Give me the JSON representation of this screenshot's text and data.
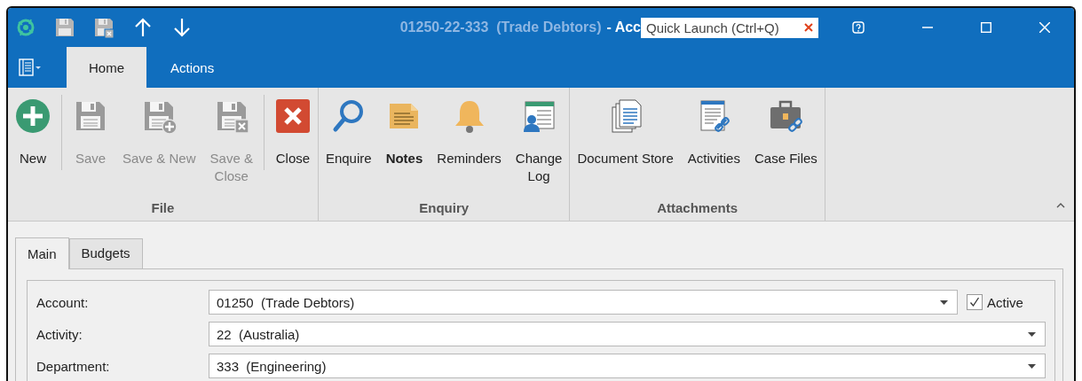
{
  "window": {
    "title_record": "01250-22-333  (Trade Debtors)",
    "title_suffix": "- Acc",
    "quick_launch": {
      "placeholder": "Quick Launch (Ctrl+Q)"
    }
  },
  "quick_access": [
    {
      "kind": "logo"
    },
    {
      "kind": "save"
    },
    {
      "kind": "save-close"
    },
    {
      "kind": "up"
    },
    {
      "kind": "down"
    }
  ],
  "ribbon_tabs": [
    {
      "label": "Home",
      "selected": true
    },
    {
      "label": "Actions",
      "selected": false
    }
  ],
  "ribbon_groups": [
    {
      "label": "File",
      "sections": [
        [
          {
            "label": "New",
            "kind": "new",
            "disabled": false,
            "bold": false
          }
        ],
        [
          {
            "label": "Save",
            "kind": "save",
            "disabled": true,
            "bold": false
          },
          {
            "label": "Save & New",
            "kind": "save-new",
            "disabled": true,
            "bold": false
          },
          {
            "label": "Save &\nClose",
            "kind": "save-close",
            "disabled": true,
            "bold": false
          }
        ],
        [
          {
            "label": "Close",
            "kind": "close",
            "disabled": false,
            "bold": false
          }
        ]
      ]
    },
    {
      "label": "Enquiry",
      "sections": [
        [
          {
            "label": "Enquire",
            "kind": "enquire",
            "disabled": false,
            "bold": false
          },
          {
            "label": "Notes",
            "kind": "notes",
            "disabled": false,
            "bold": true
          },
          {
            "label": "Reminders",
            "kind": "reminders",
            "disabled": false,
            "bold": false
          },
          {
            "label": "Change\nLog",
            "kind": "change-log",
            "disabled": false,
            "bold": false
          }
        ]
      ]
    },
    {
      "label": "Attachments",
      "sections": [
        [
          {
            "label": "Document Store",
            "kind": "documents",
            "disabled": false,
            "bold": false
          },
          {
            "label": "Activities",
            "kind": "activities",
            "disabled": false,
            "bold": false
          },
          {
            "label": "Case Files",
            "kind": "case-files",
            "disabled": false,
            "bold": false
          }
        ]
      ]
    }
  ],
  "form_tabs": [
    {
      "label": "Main",
      "selected": true
    },
    {
      "label": "Budgets",
      "selected": false
    }
  ],
  "fields": [
    {
      "label": "Account:",
      "value": "01250  (Trade Debtors)",
      "checkbox": {
        "label": "Active",
        "checked": true
      }
    },
    {
      "label": "Activity:",
      "value": "22  (Australia)"
    },
    {
      "label": "Department:",
      "value": "333  (Engineering)"
    }
  ]
}
